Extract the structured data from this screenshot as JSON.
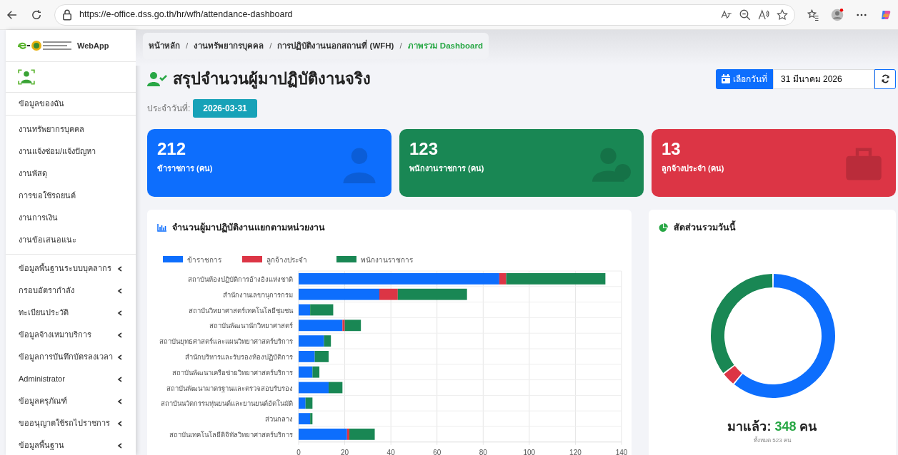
{
  "browser": {
    "url": "https://e-office.dss.go.th/hr/wfh/attendance-dashboard"
  },
  "sidebar": {
    "logo_text": "WebApp",
    "sections": [
      [
        {
          "label": "ข้อมูลของฉัน",
          "has_submenu": false
        }
      ],
      [
        {
          "label": "งานทรัพยากรบุคคล",
          "has_submenu": false
        },
        {
          "label": "งานแจ้งซ่อม/แจ้งปัญหา",
          "has_submenu": false
        },
        {
          "label": "งานพัสดุ",
          "has_submenu": false
        },
        {
          "label": "การขอใช้รถยนต์",
          "has_submenu": false
        },
        {
          "label": "งานการเงิน",
          "has_submenu": false
        },
        {
          "label": "งานข้อเสนอแนะ",
          "has_submenu": false
        }
      ],
      [
        {
          "label": "ข้อมูลพื้นฐานระบบบุคลากร",
          "has_submenu": true
        },
        {
          "label": "กรอบอัตรากำลัง",
          "has_submenu": true
        },
        {
          "label": "ทะเบียนประวัติ",
          "has_submenu": true
        },
        {
          "label": "ข้อมูลจ้างเหมาบริการ",
          "has_submenu": true
        },
        {
          "label": "ข้อมูลการบันทึกบัตรลงเวลา",
          "has_submenu": true
        },
        {
          "label": "Administrator",
          "has_submenu": true
        },
        {
          "label": "ข้อมูลครุภัณฑ์",
          "has_submenu": true
        },
        {
          "label": "ขออนุญาตใช้รถไปราชการ",
          "has_submenu": true
        },
        {
          "label": "ข้อมูลพื้นฐาน",
          "has_submenu": true
        }
      ]
    ]
  },
  "breadcrumb_separator": "/",
  "breadcrumb": [
    {
      "label": "หน้าหลัก",
      "selected": false
    },
    {
      "label": "งานทรัพยากรบุคคล",
      "selected": false
    },
    {
      "label": "การปฏิบัติงานนอกสถานที่ (WFH)",
      "selected": false
    },
    {
      "label": "ภาพรวม Dashboard",
      "selected": true
    }
  ],
  "page_title": "สรุปจำนวนผู้มาปฏิบัติงานจริง",
  "date_label": "ประจำวันที่:",
  "date_badge": "2026-03-31",
  "date_picker": {
    "button": "เลือกวันที่",
    "value": "31 มีนาคม 2026"
  },
  "stat_cards": [
    {
      "value": "212",
      "label": "ข้าราชการ (คน)",
      "color": "#0d6efd",
      "kind": "officials"
    },
    {
      "value": "123",
      "label": "พนักงานราชการ (คน)",
      "color": "#198754",
      "kind": "employees"
    },
    {
      "value": "13",
      "label": "ลูกจ้างประจำ (คน)",
      "color": "#dc3545",
      "kind": "workers"
    }
  ],
  "bar_panel": {
    "title": "จำนวนผู้มาปฏิบัติงานแยกตามหน่วยงาน",
    "chart_data": {
      "type": "bar",
      "orientation": "horizontal",
      "stacked": true,
      "categories": [
        "สถาบันห้องปฏิบัติการอ้างอิงแห่งชาติ",
        "สำนักงานเลขานุการกรม",
        "สถาบันวิทยาศาสตร์เทคโนโลยีชุมชน",
        "สถาบันพัฒนานักวิทยาศาสตร์",
        "สถาบันยุทธศาสตร์และแผนวิทยาศาสตร์บริการ",
        "สำนักบริหารและรับรองห้องปฏิบัติการ",
        "สถาบันพัฒนาเครือข่ายวิทยาศาสตร์บริการ",
        "สถาบันพัฒนามาตรฐานและตรวจสอบรับรอง",
        "สถาบันนวัตกรรมหุ่นยนต์และยานยนต์อัตโนมัติ",
        "ส่วนกลาง",
        "สถาบันเทคโนโลยีดิจิทัลวิทยาศาสตร์บริการ"
      ],
      "series": [
        {
          "name": "ข้าราชการ",
          "color": "#0d6efd",
          "values": [
            87,
            35,
            5,
            19,
            11,
            7,
            6,
            13,
            3,
            5,
            21
          ]
        },
        {
          "name": "ลูกจ้างประจำ",
          "color": "#dc3545",
          "values": [
            3,
            8,
            0,
            1,
            0,
            0,
            0,
            0,
            0,
            0,
            1
          ]
        },
        {
          "name": "พนักงานราชการ",
          "color": "#198754",
          "values": [
            43,
            30,
            10,
            7,
            3,
            6,
            3,
            6,
            3,
            1,
            11
          ]
        }
      ],
      "grid": true,
      "legend": true,
      "xlim": [
        0,
        140
      ],
      "xticks": [
        0,
        20,
        40,
        60,
        80,
        100,
        120,
        140
      ]
    }
  },
  "donut_panel": {
    "title": "สัดส่วนรวมวันนี้",
    "chart_data": {
      "type": "donut",
      "series": [
        {
          "values": [
            60.9,
            3.7,
            35.4
          ]
        }
      ],
      "colors": [
        "#0d6efd",
        "#dc3545",
        "#198754"
      ]
    },
    "summary_label": "มาแล้ว:",
    "summary_value": "348",
    "summary_unit": "คน",
    "total_text": "ทั้งหมด 523 คน"
  }
}
